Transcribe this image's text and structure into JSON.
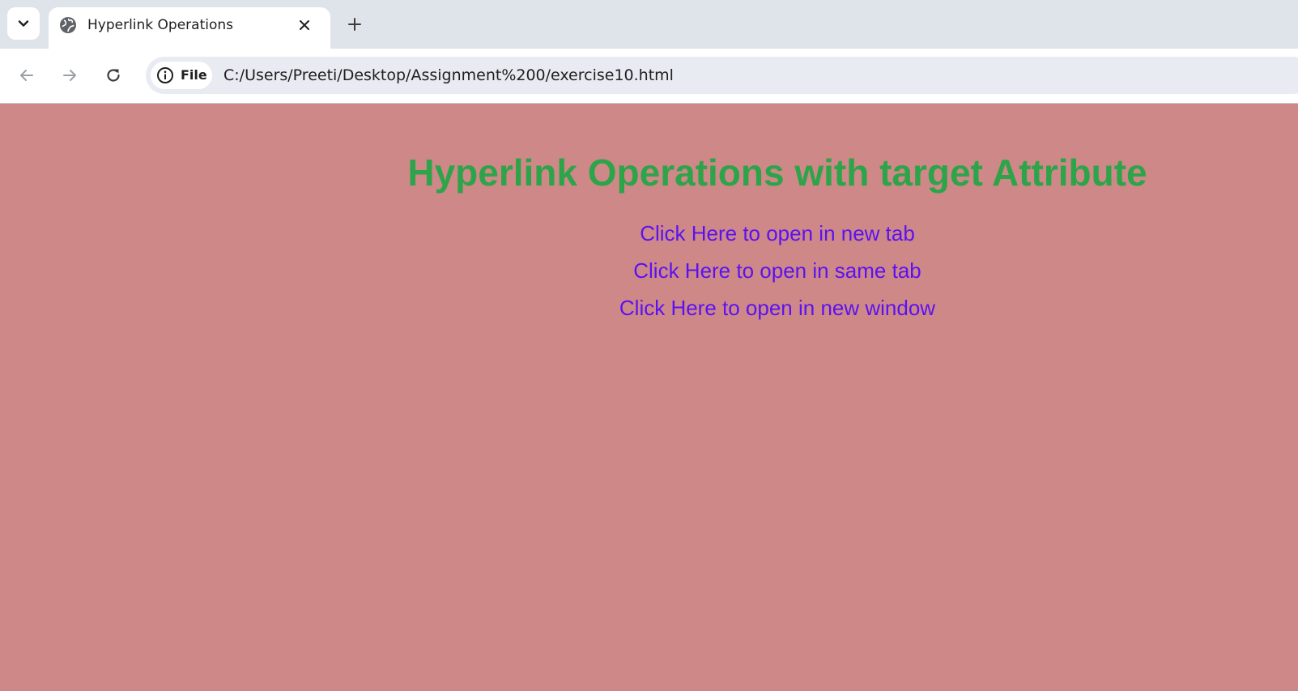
{
  "tab": {
    "title": "Hyperlink Operations",
    "favicon": "globe-icon"
  },
  "toolbar": {
    "site_info_label": "File",
    "url": "C:/Users/Preeti/Desktop/Assignment%200/exercise10.html"
  },
  "page": {
    "heading": "Hyperlink Operations with target Attribute",
    "links": [
      {
        "label": "Click Here to open in new tab"
      },
      {
        "label": "Click Here to open in same tab"
      },
      {
        "label": "Click Here to open in new window"
      }
    ],
    "colors": {
      "background": "#cf8888",
      "heading": "#2ea44a",
      "link": "#5a13f0"
    }
  }
}
